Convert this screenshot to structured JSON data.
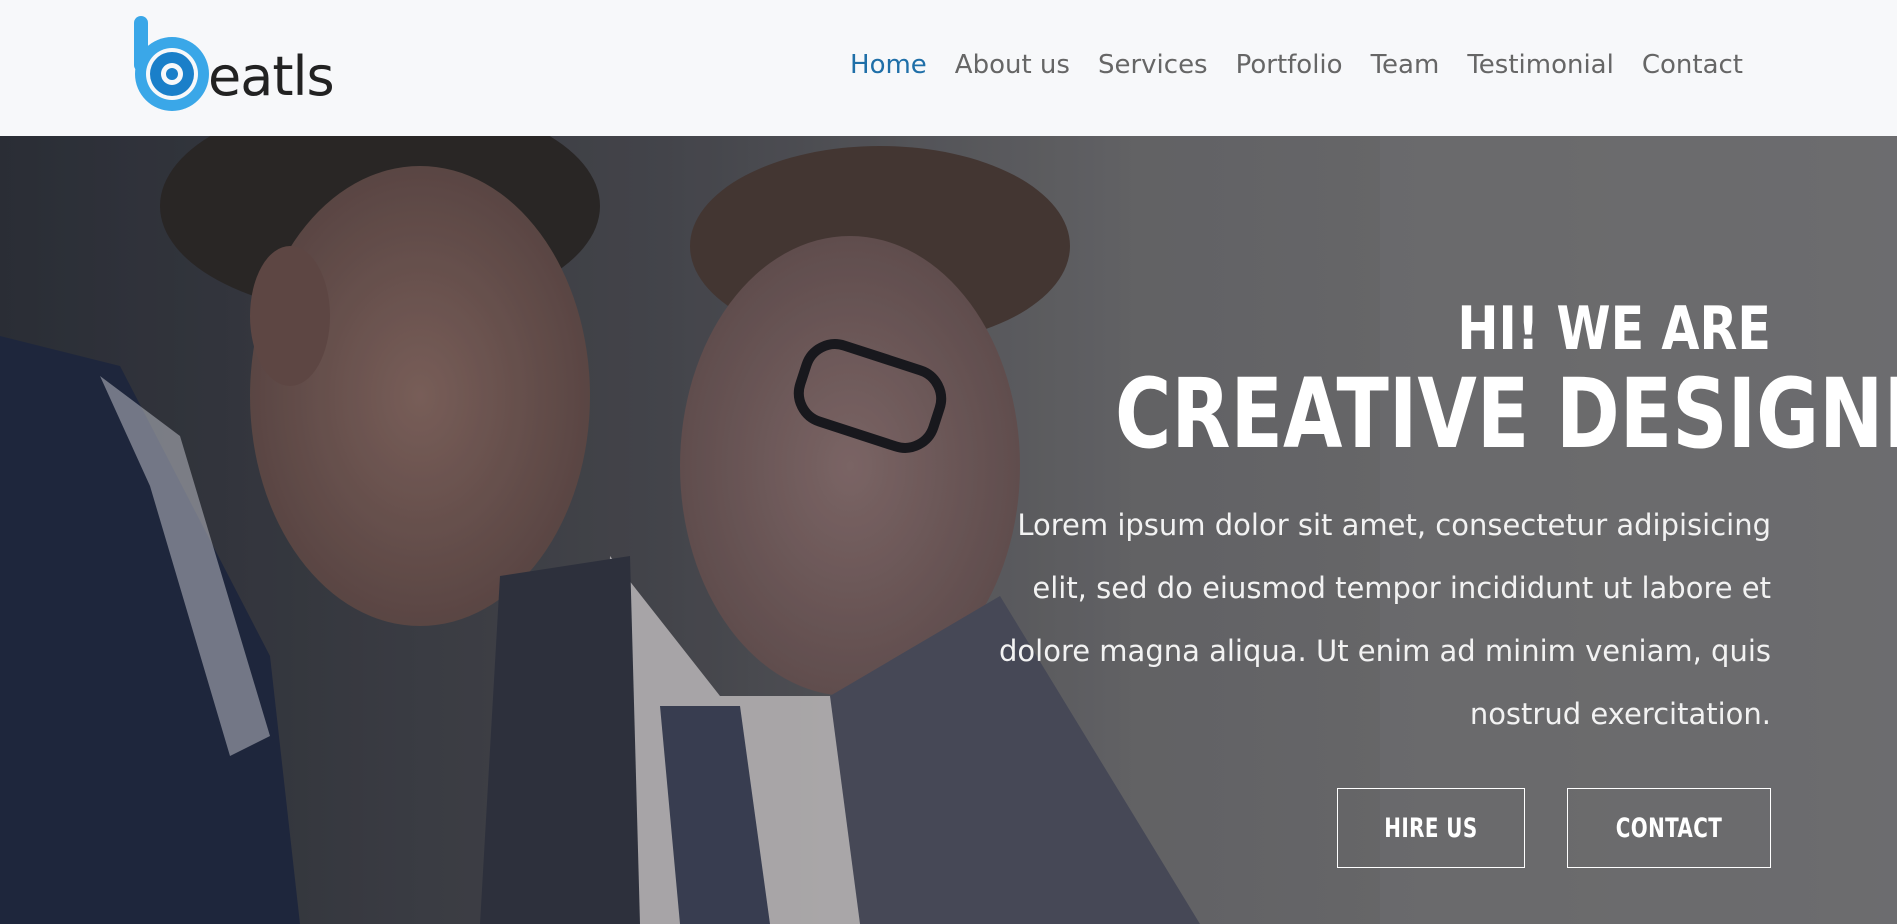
{
  "brand": {
    "logo_text": "eatls",
    "colors": {
      "logo_outer": "#3aa7e8",
      "logo_inner": "#1a7fc9"
    }
  },
  "nav": {
    "items": [
      {
        "label": "Home",
        "active": true
      },
      {
        "label": "About us",
        "active": false
      },
      {
        "label": "Services",
        "active": false
      },
      {
        "label": "Portfolio",
        "active": false
      },
      {
        "label": "Team",
        "active": false
      },
      {
        "label": "Testimonial",
        "active": false
      },
      {
        "label": "Contact",
        "active": false
      }
    ],
    "colors": {
      "active": "#1f6fa8",
      "default": "#666666"
    }
  },
  "hero": {
    "greeting": "HI! WE ARE",
    "title": "CREATIVE DESIGNER",
    "description_lines": [
      "Lorem ipsum dolor sit amet, consectetur adipisicing",
      "elit, sed do eiusmod tempor incididunt ut labore et",
      "dolore magna aliqua. Ut enim ad minim veniam, quis",
      "nostrud exercitation."
    ],
    "buttons": {
      "hire": "HIRE US",
      "contact": "CONTACT"
    }
  }
}
